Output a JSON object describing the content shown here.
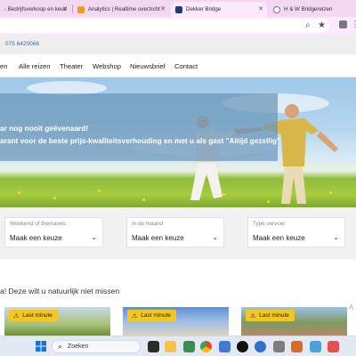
{
  "browser": {
    "tabs": [
      {
        "title": "- Bedrijfsverkoop en keuz",
        "active": false
      },
      {
        "title": "Analytics | Realtime overzicht",
        "active": false
      },
      {
        "title": "Dekker Bridge",
        "active": true
      },
      {
        "title": "H & W Bridgereizen",
        "active": false
      }
    ],
    "toolbar_icons": [
      "zoom-icon",
      "star-icon",
      "extension-icon",
      "more-icon"
    ]
  },
  "site": {
    "phone": "075 6420066",
    "nav": [
      "en",
      "Alle reizen",
      "Theater",
      "Webshop",
      "Nieuwsbrief",
      "Contact"
    ],
    "hero": {
      "line1": "ar nog nooit geëvenaard!",
      "line2": "arant voor de beste prijs-kwaliteitsverhouding en met u als gast \"Altijd gezellig\""
    },
    "filters": [
      {
        "label": "Weekend of themareis",
        "value": "Maak een keuze"
      },
      {
        "label": "In de maand",
        "value": "Maak een keuze"
      },
      {
        "label": "Type vervoer",
        "value": "Maak een keuze"
      }
    ],
    "section_title": "a!   Deze wilt u natuurlijk niet missen",
    "cards": [
      {
        "badge": "Last minute"
      },
      {
        "badge": "Last minute"
      },
      {
        "badge": "Last minute"
      }
    ],
    "side_letter": "A"
  },
  "taskbar": {
    "search_placeholder": "Zoeken"
  },
  "colors": {
    "tabstrip": "#f3d8f2",
    "accent_badge": "#f3c623",
    "search_panel": "#f1f1f1",
    "taskbar": "#e3e9f2"
  }
}
